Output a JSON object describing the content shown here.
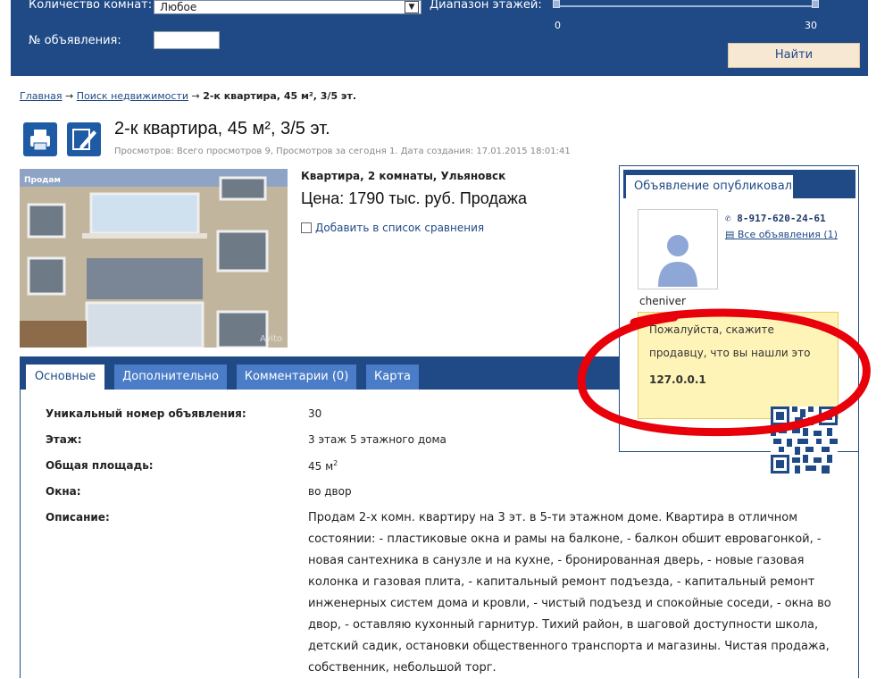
{
  "search": {
    "rooms_label": "Количество комнат:",
    "rooms_value": "Любое",
    "floors_label": "Диапазон этажей:",
    "floor_min": "0",
    "floor_max": "30",
    "ad_number_label": "№ объявления:",
    "find_button": "Найти"
  },
  "breadcrumb": {
    "home": "Главная",
    "search": "Поиск недвижимости",
    "current": "2-к квартира, 45 м², 3/5 эт."
  },
  "listing": {
    "title": "2-к квартира, 45 м², 3/5 эт.",
    "stats": "Просмотров: Всего просмотров 9, Просмотров за сегодня 1.   Дата создания: 17.01.2015 18:01:41",
    "photo_badge": "Продам",
    "photo_watermark": "Avito",
    "subtitle": "Квартира, 2 комнаты, Ульяновск",
    "price": "Цена: 1790 тыс. руб. Продажа",
    "compare_label": "Добавить в список сравнения"
  },
  "tabs": [
    "Основные",
    "Дополнительно",
    "Комментарии (0)",
    "Карта"
  ],
  "properties": [
    {
      "label": "Уникальный номер объявления:",
      "value": "30"
    },
    {
      "label": "Этаж:",
      "value": "3 этаж 5 этажного дома"
    },
    {
      "label": "Общая площадь:",
      "value": "45 м",
      "sup": "2"
    },
    {
      "label": "Окна:",
      "value": "во двор"
    },
    {
      "label": "Описание:",
      "value": ""
    }
  ],
  "description": "Продам 2-х комн. квартиру на 3 эт. в 5-ти этажном доме. Квартира в отличном состоянии: - пластиковые окна и рамы на балконе, - балкон обшит евровагонкой, - новая сантехника в санузле и на кухне, - бронированная дверь, - новые газовая колонка и газовая плита, - капитальный ремонт подъезда, - капитальный ремонт инженерных систем дома и кровли, - чистый подъезд и спокойные соседи, - окна во двор, - оставляю кухонный гарнитур. Тихий район, в шаговой доступности школа, детский садик, остановки общественного транспорта и магазины. Чистая продажа, собственник, небольшой торг.",
  "seller": {
    "header": "Объявление опубликовал",
    "phone": "8-917-620-24-61",
    "all_ads": "Все объявления (1)",
    "username": "cheniver",
    "notice": "Пожалуйста, скажите продавцу, что вы нашли это",
    "ip": "127.0.0.1"
  },
  "colors": {
    "brand": "#1f4a86",
    "tab": "#4a7cc7",
    "notice_bg": "#fff4b8",
    "annotation": "#e8000a"
  }
}
